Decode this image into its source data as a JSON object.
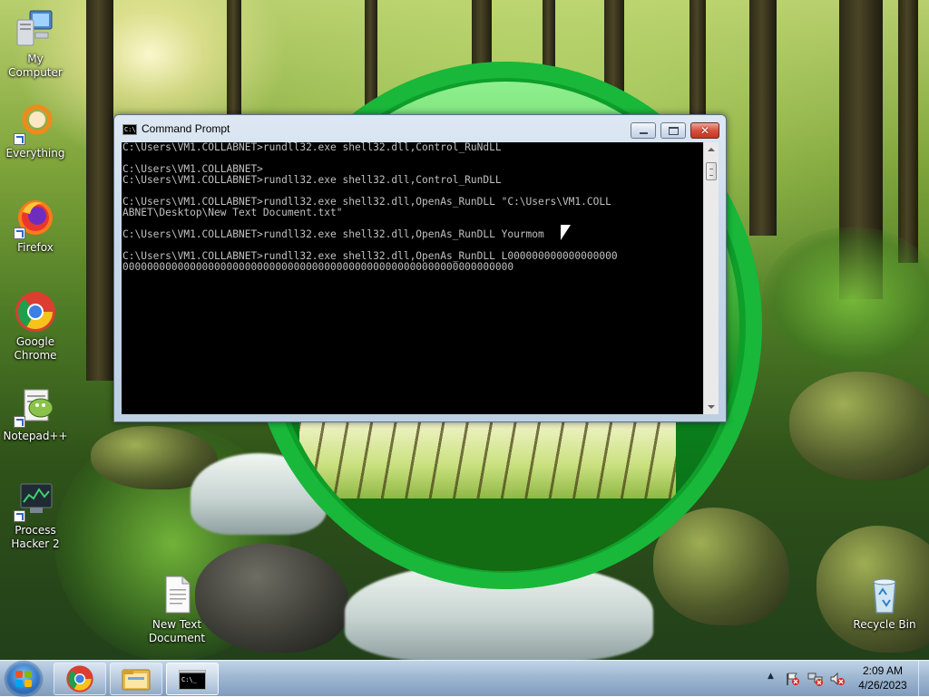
{
  "desktop": {
    "icons": [
      {
        "id": "my-computer",
        "label": "My Computer"
      },
      {
        "id": "everything",
        "label": "Everything"
      },
      {
        "id": "firefox",
        "label": "Firefox"
      },
      {
        "id": "chrome",
        "label": "Google Chrome"
      },
      {
        "id": "notepadpp",
        "label": "Notepad++"
      },
      {
        "id": "process-hacker",
        "label": "Process Hacker 2"
      },
      {
        "id": "new-text-document",
        "label": "New Text Document"
      },
      {
        "id": "recycle-bin",
        "label": "Recycle Bin"
      }
    ]
  },
  "cmd": {
    "title": "Command Prompt",
    "icon_text": "C:\\",
    "close_glyph": "✕",
    "output": "C:\\Users\\VM1.COLLABNET>rundll32.exe shell32.dll,Control_RuNdLL\n\nC:\\Users\\VM1.COLLABNET>\nC:\\Users\\VM1.COLLABNET>rundll32.exe shell32.dll,Control_RunDLL\n\nC:\\Users\\VM1.COLLABNET>rundll32.exe shell32.dll,OpenAs_RunDLL \"C:\\Users\\VM1.COLL\nABNET\\Desktop\\New Text Document.txt\"\n\nC:\\Users\\VM1.COLLABNET>rundll32.exe shell32.dll,OpenAs_RunDLL Yourmom\n\nC:\\Users\\VM1.COLLABNET>rundll32.exe shell32.dll,OpenAs_RunDLL L000000000000000000\n0000000000000000000000000000000000000000000000000000000000000000"
  },
  "taskbar": {
    "pinned": [
      "chrome-icon",
      "file-explorer-icon",
      "command-prompt-icon"
    ],
    "clock": {
      "time": "2:09 AM",
      "date": "4/26/2023"
    },
    "tray_expand_glyph": "▲"
  },
  "colors": {
    "circle_green": "#0f9e2a",
    "console_bg": "#000000",
    "console_fg": "#c0c0c0",
    "close_red": "#c23622"
  }
}
